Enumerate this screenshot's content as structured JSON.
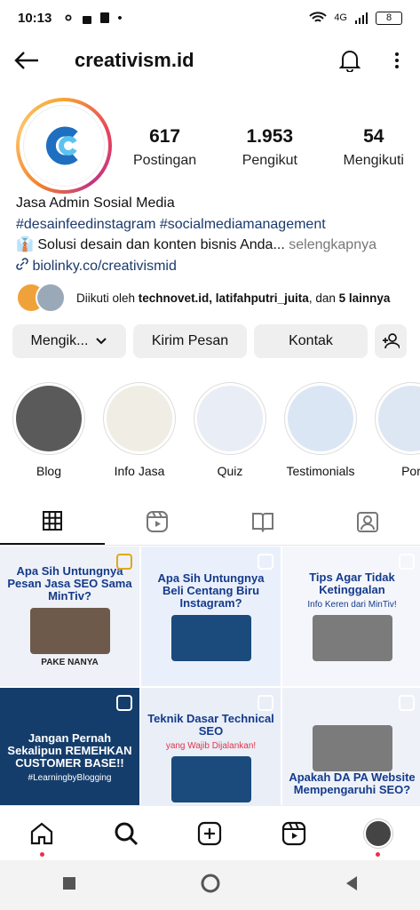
{
  "status_bar": {
    "time": "10:13",
    "network_label": "4G",
    "battery": "8"
  },
  "header": {
    "username": "creativism.id"
  },
  "profile": {
    "posts_count": "617",
    "posts_label": "Postingan",
    "followers_count": "1.953",
    "followers_label": "Pengikut",
    "following_count": "54",
    "following_label": "Mengikuti",
    "name": "Jasa Admin Sosial Media",
    "hashtags": "#desainfeedinstagram #socialmediamanagement",
    "tagline": "Solusi desain dan konten bisnis Anda...",
    "more_label": "selengkapnya",
    "link": "biolinky.co/creativismid",
    "followed_by_prefix": "Diikuti oleh",
    "followed_by_names": "technovet.id, latifahputri_juita",
    "followed_by_and": ", dan",
    "followed_by_more": "5 lainnya"
  },
  "buttons": {
    "following": "Mengik...",
    "message": "Kirim Pesan",
    "contact": "Kontak"
  },
  "highlights": [
    {
      "label": "Blog",
      "color": "#5a5a5a"
    },
    {
      "label": "Info Jasa",
      "color": "#f0ede4"
    },
    {
      "label": "Quiz",
      "color": "#e9edf5"
    },
    {
      "label": "Testimonials",
      "color": "#dbe6f5"
    },
    {
      "label": "Por",
      "color": "#dde7f3"
    }
  ],
  "grid": [
    {
      "headline": "Apa Sih Untungnya Pesan Jasa SEO Sama MinTiv?",
      "sub": "PAKE NANYA"
    },
    {
      "headline": "Apa Sih Untungnya Beli Centang Biru Instagram?",
      "sub": ""
    },
    {
      "headline": "Tips Agar Tidak Ketinggalan",
      "sub": "Info Keren dari MinTiv!"
    },
    {
      "headline": "Jangan Pernah Sekalipun REMEHKAN CUSTOMER BASE!!",
      "sub": "#LearningbyBlogging"
    },
    {
      "headline": "Teknik Dasar Technical SEO",
      "sub": "yang Wajib Dijalankan!"
    },
    {
      "headline": "Apakah DA PA Website Mempengaruhi SEO?",
      "sub": ""
    }
  ]
}
